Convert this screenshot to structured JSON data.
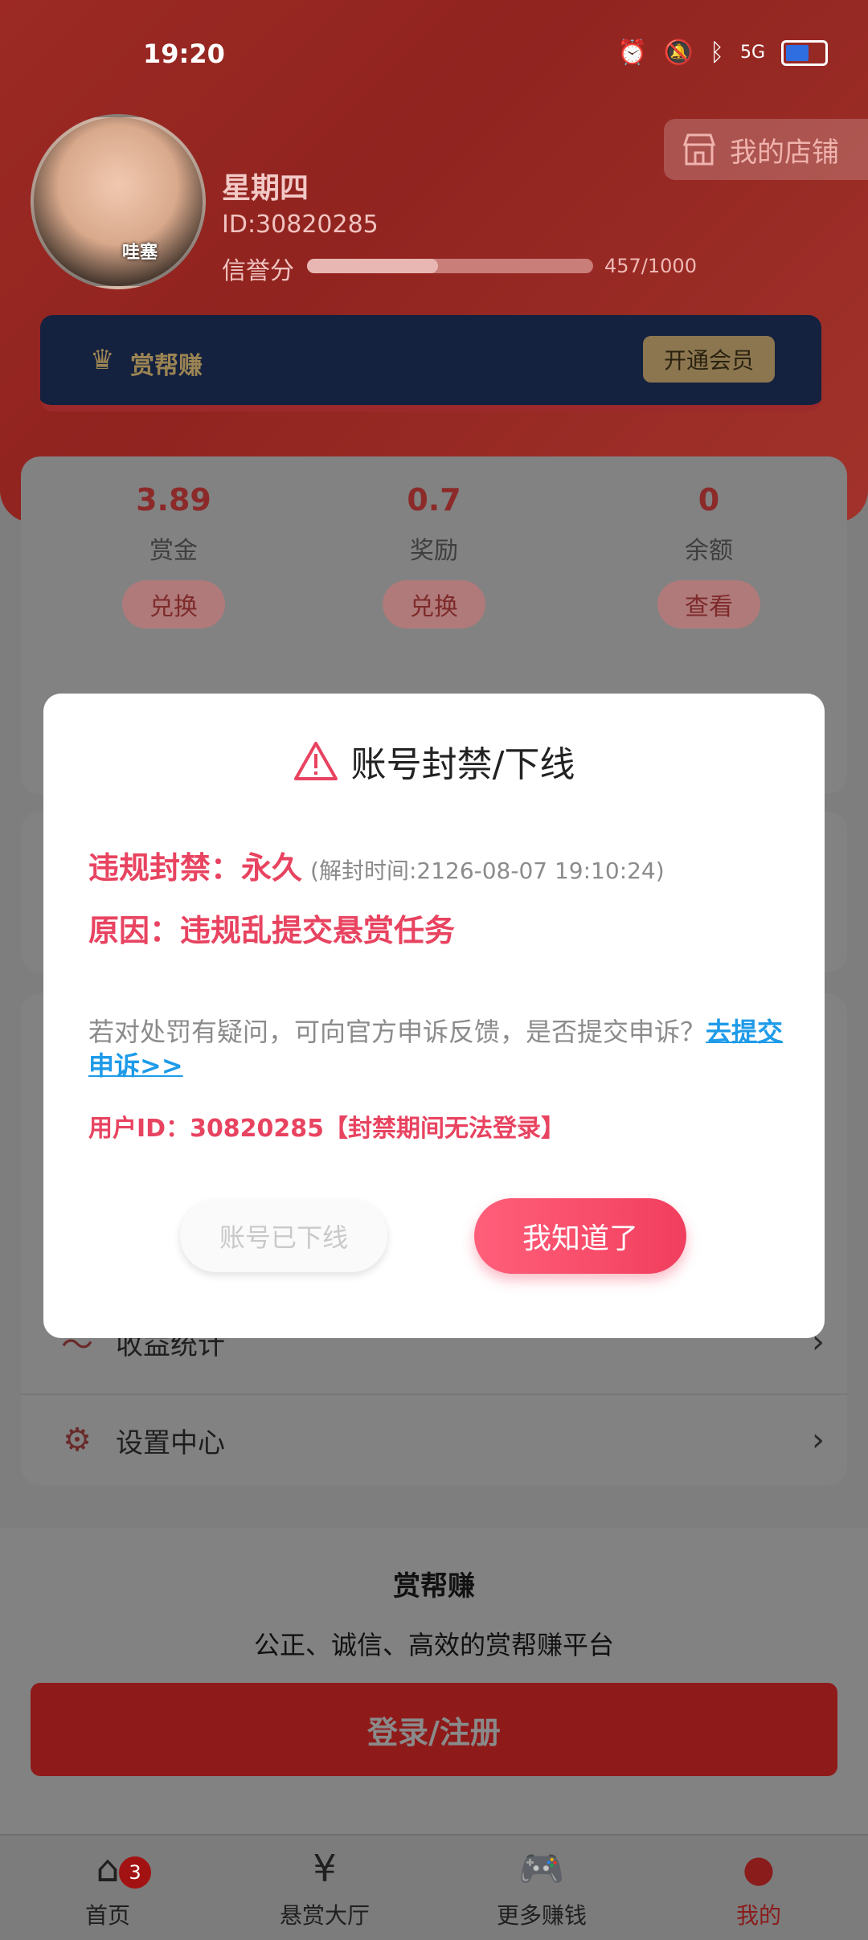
{
  "status_bar": {
    "time": "19:20",
    "network": "5G"
  },
  "profile": {
    "name": "星期四",
    "id_text": "ID:30820285",
    "credit_label": "信誉分",
    "credit_value": "457/1000",
    "credit_progress": 0.457,
    "store_button": "我的店铺",
    "avatar_caption": "哇塞"
  },
  "vip": {
    "label": "赏帮赚",
    "button": "开通会员"
  },
  "stats": [
    {
      "value": "3.89",
      "label": "赏金",
      "button": "兑换"
    },
    {
      "value": "0.7",
      "label": "奖励",
      "button": "兑换"
    },
    {
      "value": "0",
      "label": "余额",
      "button": "查看"
    }
  ],
  "menu": [
    {
      "label": "收益统计",
      "icon": "chart-icon"
    },
    {
      "label": "设置中心",
      "icon": "gear-icon"
    }
  ],
  "login_panel": {
    "title": "赏帮赚",
    "slogan": "公正、诚信、高效的赏帮赚平台",
    "login_button": "登录/注册"
  },
  "tabs": [
    {
      "label": "首页",
      "icon": "home-icon",
      "badge": "3"
    },
    {
      "label": "悬赏大厅",
      "icon": "reward-icon"
    },
    {
      "label": "更多赚钱",
      "icon": "gamepad-icon"
    },
    {
      "label": "我的",
      "icon": "user-icon",
      "active": true
    }
  ],
  "modal": {
    "title": "账号封禁/下线",
    "ban_label": "违规封禁：永久",
    "unban_time": "(解封时间:2126-08-07 19:10:24)",
    "reason": "原因：违规乱提交悬赏任务",
    "appeal_text": "若对处罚有疑问，可向官方申诉反馈，是否提交申诉？",
    "appeal_link": "去提交申诉>>",
    "user_line": "用户ID：30820285【封禁期间无法登录】",
    "offline_button": "账号已下线",
    "ok_button": "我知道了"
  },
  "colors": {
    "accent_red": "#e84360",
    "link_blue": "#1e9be9",
    "header_red": "#d83a32"
  }
}
